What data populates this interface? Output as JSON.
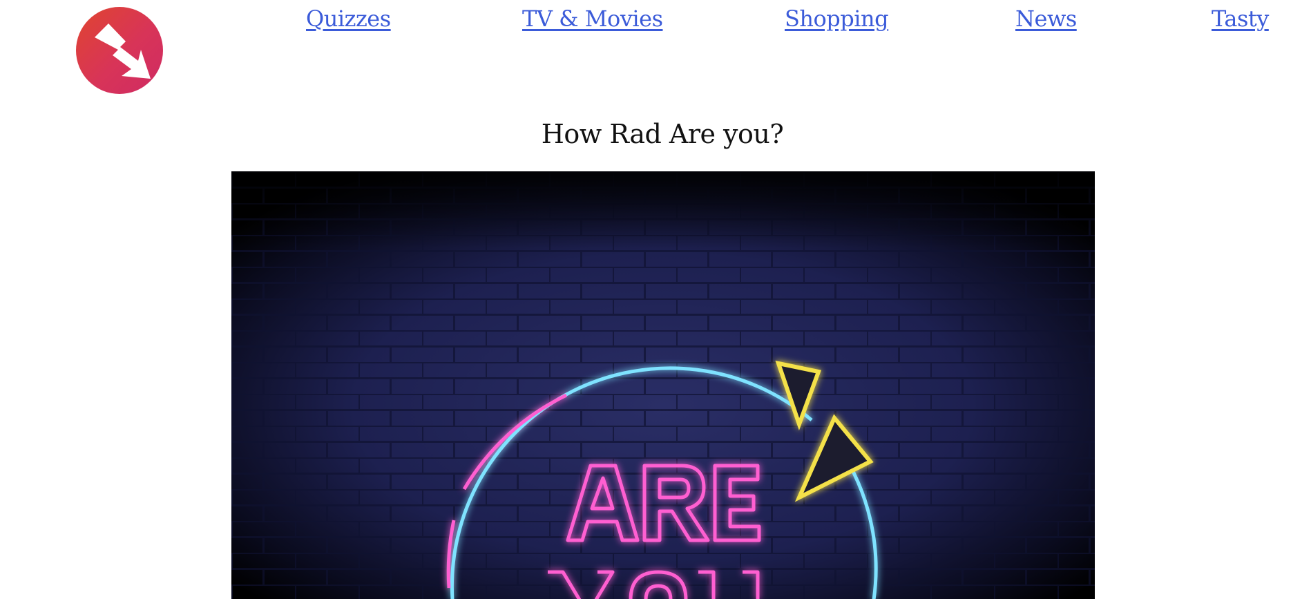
{
  "header": {
    "logo_icon": "buzzfeed-arrow-logo-icon",
    "nav": [
      {
        "label": "Quizzes"
      },
      {
        "label": "TV & Movies"
      },
      {
        "label": "Shopping"
      },
      {
        "label": "News"
      },
      {
        "label": "Tasty"
      }
    ]
  },
  "main": {
    "quiz_title": "How Rad Are you?",
    "hero_image": {
      "icon": "neon-sign-image",
      "sign_text": "ARE YOU"
    }
  },
  "colors": {
    "link": "#3b5bd9",
    "logo_red": "#d83458",
    "neon_pink": "#ff5fd1",
    "neon_cyan": "#7fe3ff",
    "neon_yellow": "#f4e14a",
    "brick_wall": "#1e2150"
  }
}
